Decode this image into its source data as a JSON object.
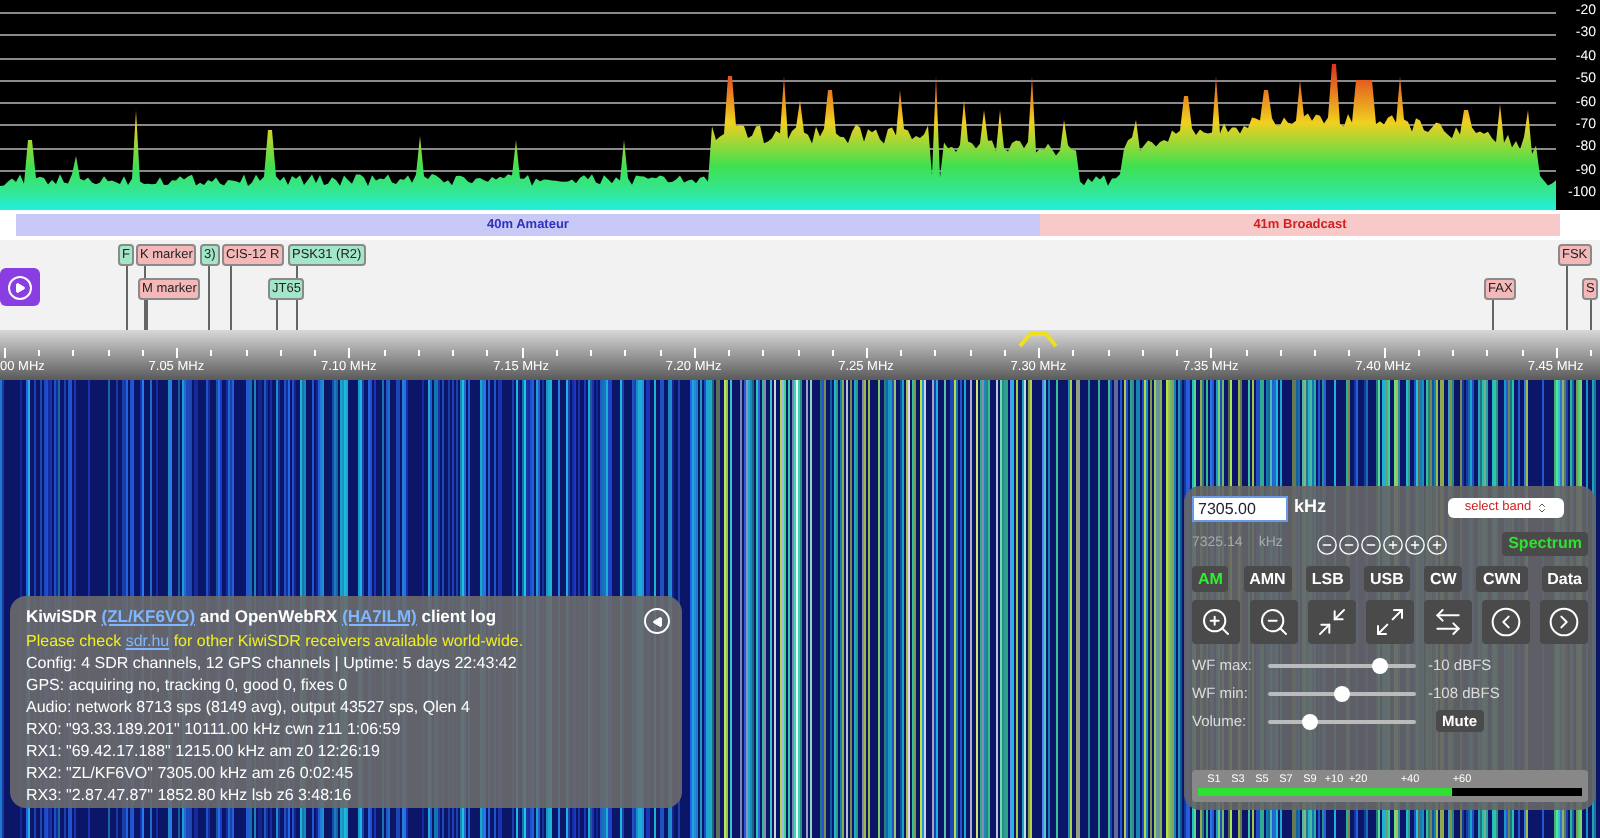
{
  "spectrum": {
    "db_labels": [
      "-20",
      "-30",
      "-40",
      "-50",
      "-60",
      "-70",
      "-80",
      "-90",
      "-100"
    ]
  },
  "bands": [
    {
      "label": "40m Amateur",
      "color": "#c9c9f7"
    },
    {
      "label": "41m Broadcast",
      "color": "#f8c9c9"
    }
  ],
  "markers": [
    {
      "text": "F",
      "color": "#a3e6ca"
    },
    {
      "text": "K marker",
      "color": "#f5b8b8"
    },
    {
      "text": "3)",
      "color": "#a3e6ca"
    },
    {
      "text": "CIS-12 R",
      "color": "#f5b8b8"
    },
    {
      "text": "PSK31 (R2)",
      "color": "#a3e6ca"
    },
    {
      "text": "FSK",
      "color": "#f5b8b8"
    },
    {
      "text": "M marker",
      "color": "#f5b8b8"
    },
    {
      "text": "JT65",
      "color": "#a3e6ca"
    },
    {
      "text": "FAX",
      "color": "#f5b8b8"
    },
    {
      "text": "S",
      "color": "#f5b8b8"
    }
  ],
  "scale": {
    "labels": [
      "00 MHz",
      "7.05 MHz",
      "7.10 MHz",
      "7.15 MHz",
      "7.20 MHz",
      "7.25 MHz",
      "7.30 MHz",
      "7.35 MHz",
      "7.40 MHz",
      "7.45 MHz"
    ]
  },
  "log": {
    "title": [
      {
        "text": "KiwiSDR ",
        "link": false
      },
      {
        "text": "(ZL/KF6VO)",
        "link": true
      },
      {
        "text": " and OpenWebRX ",
        "link": false
      },
      {
        "text": "(HA7ILM)",
        "link": true
      },
      {
        "text": " client log",
        "link": false
      }
    ],
    "notice": [
      {
        "text": "Please check ",
        "link": false
      },
      {
        "text": "sdr.hu",
        "link": true
      },
      {
        "text": " for other KiwiSDR receivers available world-wide.",
        "link": false
      }
    ],
    "lines": [
      "Config: 4 SDR channels, 12 GPS channels | Uptime: 5 days 22:43:42",
      "GPS: acquiring no, tracking 0, good 0, fixes 0",
      "Audio: network 8713 sps (8149 avg), output 43527 sps, Qlen 4",
      "RX0: \"93.33.189.201\" 10111.00 kHz cwn z11 1:06:59",
      "RX1: \"69.42.17.188\" 1215.00 kHz am z0 12:26:19",
      "RX2: \"ZL/KF6VO\" 7305.00 kHz am z6 0:02:45",
      "RX3: \"2.87.47.87\" 1852.80 kHz lsb z6 3:48:16"
    ]
  },
  "controls": {
    "frequency": "7305.00",
    "unit": "kHz",
    "band_select": "select band",
    "readout": "7325.14",
    "readout_unit": "kHz",
    "spectrum_button": "Spectrum",
    "modes": [
      {
        "label": "AM",
        "selected": true
      },
      {
        "label": "AMN",
        "selected": false
      },
      {
        "label": "LSB",
        "selected": false
      },
      {
        "label": "USB",
        "selected": false
      },
      {
        "label": "CW",
        "selected": false
      },
      {
        "label": "CWN",
        "selected": false
      },
      {
        "label": "Data",
        "selected": false
      }
    ],
    "sliders": [
      {
        "label": "WF max:",
        "level": 0.76,
        "reading": "-10 dBFS"
      },
      {
        "label": "WF min:",
        "level": 0.5,
        "reading": "-108 dBFS"
      },
      {
        "label": "Volume:",
        "level": 0.28,
        "button": "Mute"
      }
    ],
    "smeter": {
      "labels": [
        "S1",
        "S3",
        "S5",
        "S7",
        "S9",
        "+10",
        "+20",
        "+40",
        "+60"
      ],
      "level": 0.66
    }
  }
}
